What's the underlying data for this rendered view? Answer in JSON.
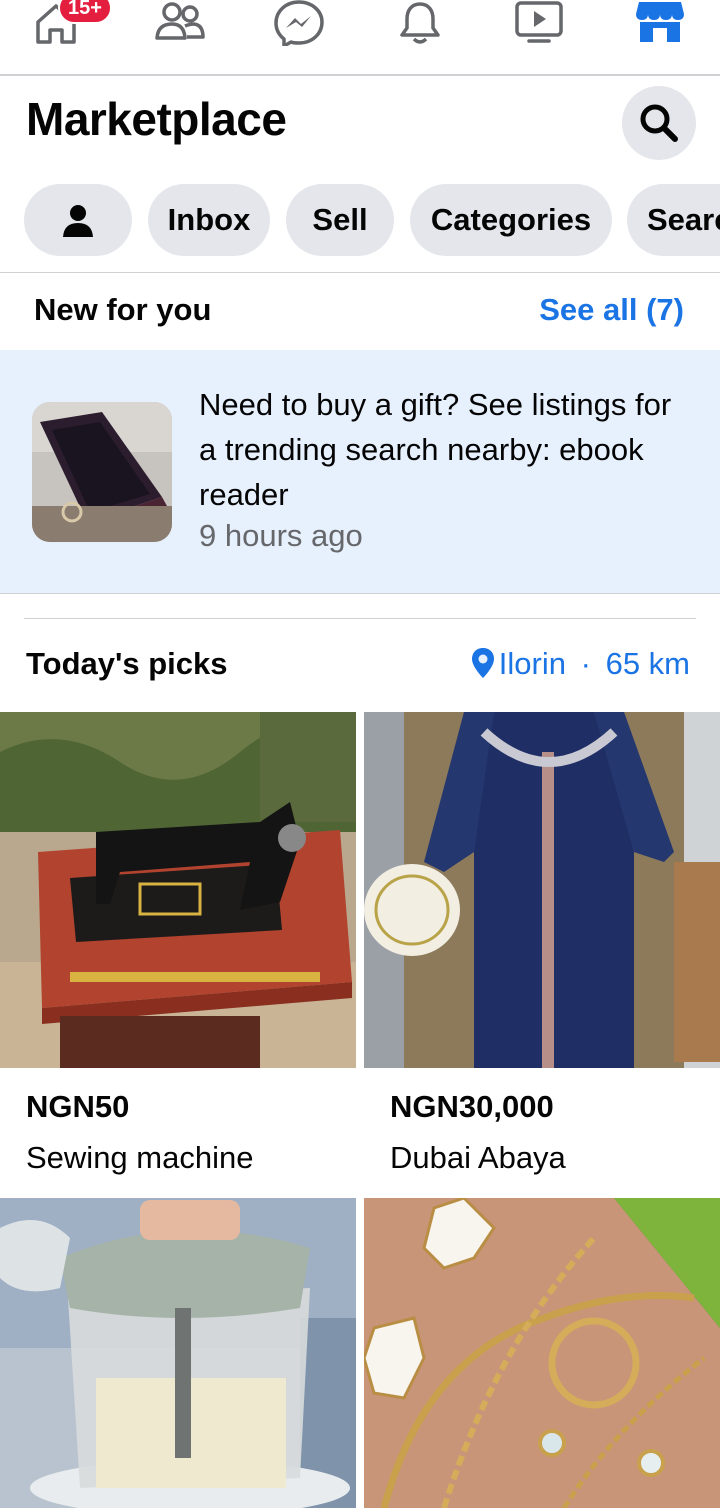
{
  "nav": {
    "badge": "15+",
    "items": [
      "home-icon",
      "friends-icon",
      "messenger-icon",
      "notifications-icon",
      "video-icon",
      "marketplace-icon"
    ],
    "active": "marketplace-icon",
    "active_color": "#1b74e4"
  },
  "header": {
    "title": "Marketplace",
    "search_icon": "search-icon"
  },
  "chips": {
    "profile_icon": "person-icon",
    "inbox": "Inbox",
    "sell": "Sell",
    "categories": "Categories",
    "search": "Search"
  },
  "new_for_you": {
    "title": "New for you",
    "see_all": "See all (7)",
    "notification": {
      "text": "Need to buy a gift? See listings for a trending search nearby: ebook reader",
      "time": "9 hours ago"
    }
  },
  "todays_picks": {
    "title": "Today's picks",
    "location": "Ilorin",
    "separator": "·",
    "distance": "65 km",
    "items": [
      {
        "price": "NGN50",
        "name": "Sewing machine"
      },
      {
        "price": "NGN30,000",
        "name": "Dubai Abaya"
      },
      {
        "price": "",
        "name": ""
      },
      {
        "price": "",
        "name": ""
      }
    ]
  },
  "colors": {
    "accent": "#1b74e4",
    "chip_bg": "#e4e6eb",
    "notification_bg": "#e7f0fd",
    "badge": "#e41e3f"
  }
}
